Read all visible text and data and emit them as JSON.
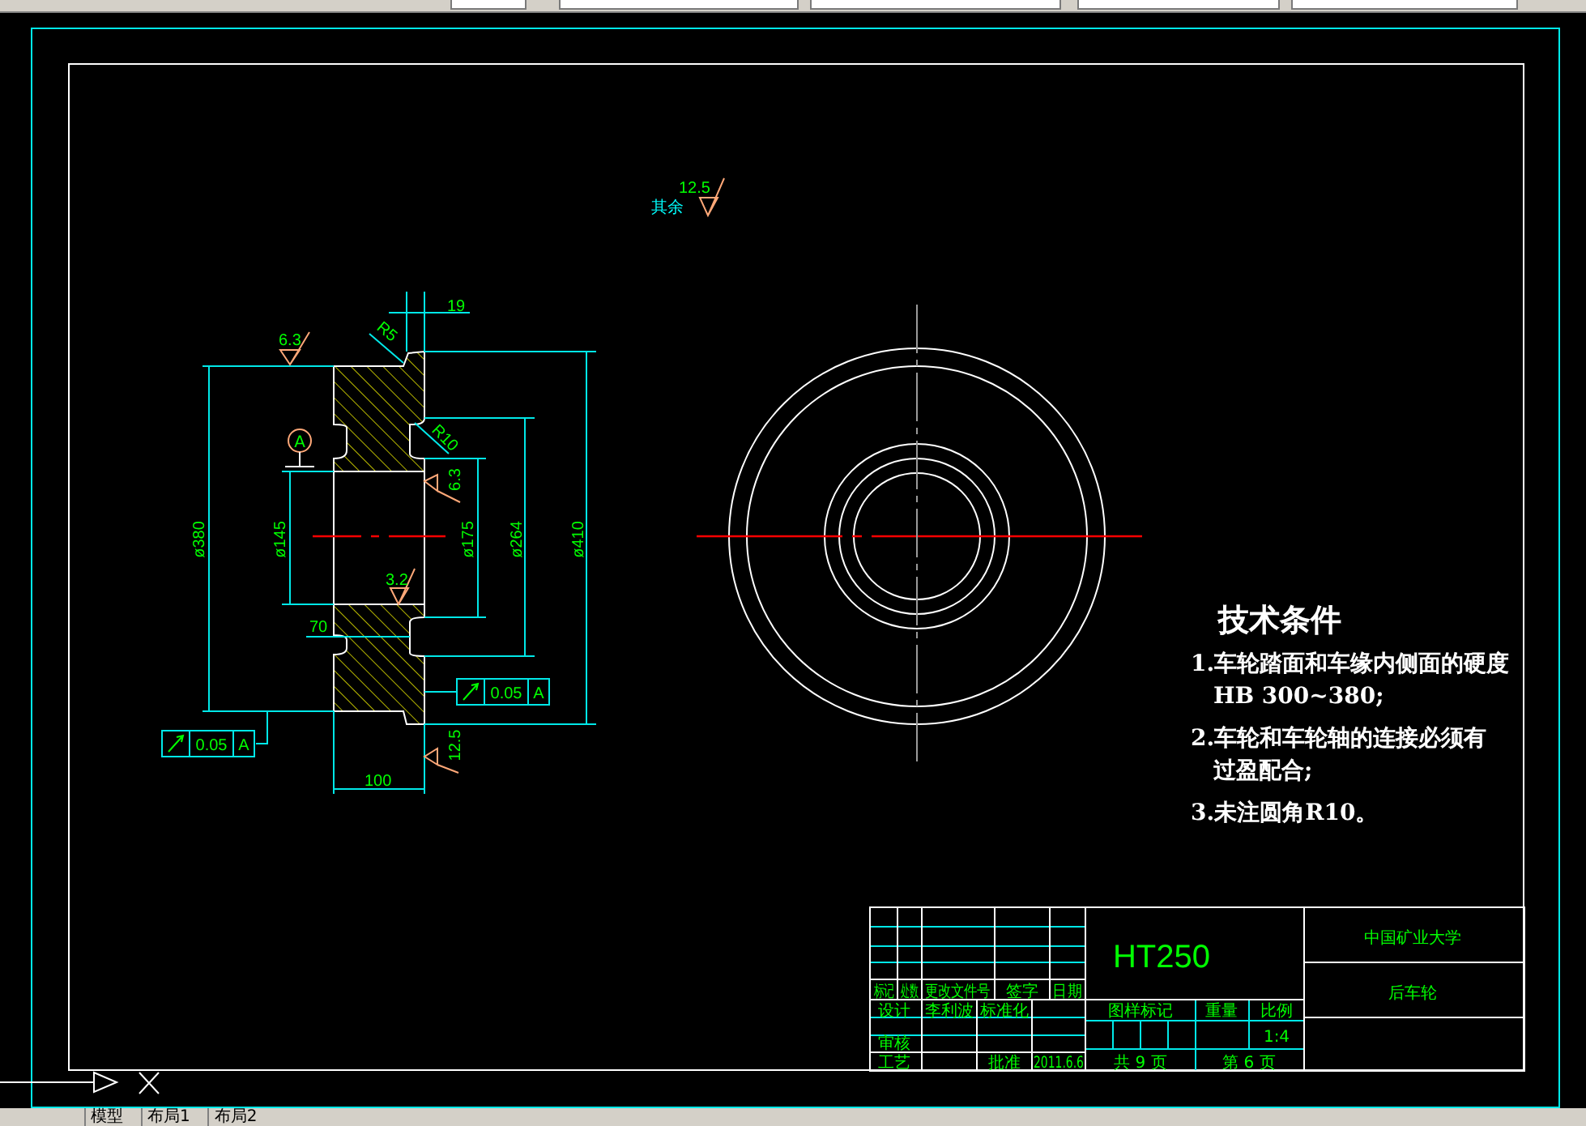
{
  "surface_note": {
    "label": "其余",
    "roughness": "12.5"
  },
  "section_view": {
    "labels": [
      "19",
      "R5",
      "6.3",
      "R10",
      "6.3",
      "ø145",
      "ø175",
      "ø264",
      "ø410",
      "ø380",
      "3.2",
      "70",
      "12.5",
      "100"
    ],
    "datum": "A",
    "tolerance_frames": [
      {
        "value": "0.05",
        "datum": "A"
      },
      {
        "value": "0.05",
        "datum": "A"
      }
    ]
  },
  "technical_requirements": {
    "title": "技术条件",
    "items": [
      {
        "lines": [
          "1.车轮踏面和车缘内侧面的硬度",
          "HB 300~380;"
        ]
      },
      {
        "lines": [
          "2.车轮和车轮轴的连接必须有",
          "过盈配合;"
        ]
      },
      {
        "lines": [
          "3.未注圆角R10。"
        ]
      }
    ]
  },
  "title_block": {
    "material": "HT250",
    "school": "中国矿业大学",
    "part_name": "后车轮",
    "cells": [
      "标记",
      "处数",
      "更改文件号",
      "签字",
      "日期",
      "设计",
      "李利波",
      "标准化",
      "审核",
      "工艺",
      "批准",
      "2011.6.6",
      "图样标记",
      "重量",
      "比例",
      "1:4",
      "共 9 页",
      "第 6 页"
    ]
  },
  "layout_tabs": [
    "模型",
    "布局1",
    "布局2"
  ]
}
